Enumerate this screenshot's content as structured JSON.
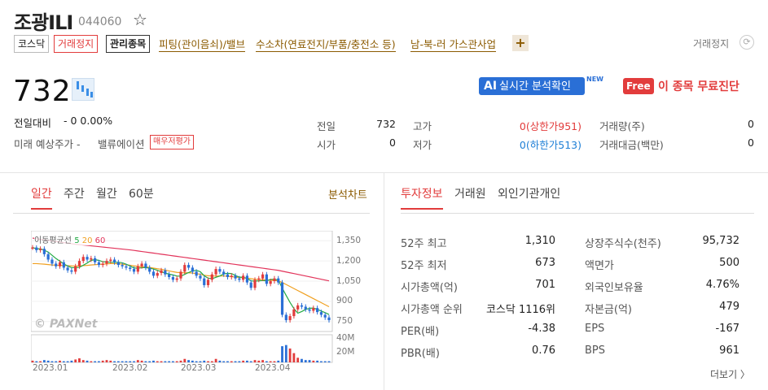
{
  "stock": {
    "name": "조광ILI",
    "code": "044060",
    "tags": [
      "코스닥",
      "거래정지",
      "관리종목"
    ],
    "themes": [
      "피팅(관이음쇠)/밸브",
      "수소차(연료전지/부품/충전소 등)",
      "남-북-러 가스관사업"
    ],
    "trade_status": "거래정지",
    "price": "732",
    "change_label": "전일대비",
    "change_value": "- 0 0.00%",
    "forecast_label": "미래 예상주가 -",
    "valuation_label": "밸류에이션",
    "valuation_badge": "매우저평가"
  },
  "promo": {
    "ai_prefix": "AI",
    "ai_text": "실시간 분석확인",
    "ai_new": "NEW",
    "free_badge": "Free",
    "free_text": "이 종목 무료진단"
  },
  "quote": {
    "prev_label": "전일",
    "prev_value": "732",
    "open_label": "시가",
    "open_value": "0",
    "high_label": "고가",
    "high_value": "0(상한가951)",
    "low_label": "저가",
    "low_value": "0(하한가513)",
    "vol_label": "거래량(주)",
    "vol_value": "0",
    "amt_label": "거래대금(백만)",
    "amt_value": "0"
  },
  "chart_tabs": [
    "일간",
    "주간",
    "월간",
    "60분"
  ],
  "chart_link": "분석차트",
  "info_tabs": [
    "투자정보",
    "거래원",
    "외인기관개인"
  ],
  "chart_data": {
    "type": "line",
    "legend_prefix": "이동평균선",
    "legend_items": [
      {
        "label": "5",
        "color": "#22aa44"
      },
      {
        "label": "20",
        "color": "#f0a020"
      },
      {
        "label": "60",
        "color": "#e2335a"
      }
    ],
    "watermark": "© PAXNet",
    "y_ticks": [
      "1,350",
      "1,200",
      "1,050",
      "900",
      "750"
    ],
    "vol_ticks": [
      "40M",
      "20M"
    ],
    "x_ticks": [
      "2023.01",
      "2023.02",
      "2023.03",
      "2023.04"
    ],
    "ylim": [
      700,
      1400
    ],
    "price": [
      1300,
      1280,
      1290,
      1250,
      1210,
      1180,
      1160,
      1190,
      1150,
      1130,
      1120,
      1160,
      1200,
      1230,
      1210,
      1220,
      1190,
      1170,
      1180,
      1200,
      1210,
      1190,
      1170,
      1160,
      1150,
      1140,
      1120,
      1160,
      1180,
      1150,
      1120,
      1090,
      1110,
      1130,
      1100,
      1080,
      1060,
      1070,
      1120,
      1170,
      1150,
      1120,
      1090,
      1070,
      1020,
      1060,
      1100,
      1140,
      1120,
      1100,
      1080,
      1090,
      1070,
      1060,
      1090,
      1040,
      1000,
      1060,
      1070,
      1100,
      1030,
      1050,
      1070,
      1040,
      800,
      760,
      790,
      840,
      870,
      860,
      840,
      830,
      850,
      820,
      800,
      780,
      760
    ],
    "ma20": [
      1180,
      1180,
      1178,
      1176,
      1173,
      1170,
      1168,
      1167,
      1166,
      1165,
      1163,
      1162,
      1163,
      1165,
      1167,
      1170,
      1172,
      1174,
      1176,
      1178,
      1180,
      1180,
      1179,
      1176,
      1172,
      1168,
      1163,
      1160,
      1158,
      1156,
      1152,
      1147,
      1142,
      1138,
      1132,
      1126,
      1120,
      1115,
      1113,
      1112,
      1112,
      1110,
      1106,
      1100,
      1094,
      1090,
      1088,
      1088,
      1088,
      1088,
      1086,
      1083,
      1080,
      1077,
      1076,
      1073,
      1068,
      1064,
      1062,
      1062,
      1058,
      1056,
      1055,
      1052,
      1040,
      1025,
      1010,
      995,
      980,
      965,
      950,
      935,
      920,
      905,
      890,
      875,
      860
    ],
    "ma60": [
      1370,
      1365,
      1360,
      1356,
      1352,
      1348,
      1344,
      1340,
      1336,
      1332,
      1328,
      1324,
      1321,
      1318,
      1315,
      1312,
      1309,
      1306,
      1303,
      1300,
      1297,
      1294,
      1291,
      1288,
      1285,
      1282,
      1278,
      1274,
      1270,
      1266,
      1262,
      1258,
      1254,
      1250,
      1246,
      1242,
      1238,
      1234,
      1230,
      1226,
      1222,
      1218,
      1214,
      1210,
      1206,
      1202,
      1198,
      1194,
      1190,
      1186,
      1182,
      1178,
      1174,
      1170,
      1166,
      1162,
      1158,
      1154,
      1150,
      1146,
      1142,
      1138,
      1134,
      1130,
      1124,
      1118,
      1112,
      1106,
      1100,
      1094,
      1088,
      1082,
      1076,
      1070,
      1064,
      1058,
      1052
    ],
    "volume": [
      3,
      2,
      2,
      4,
      3,
      2,
      2,
      3,
      2,
      2,
      3,
      5,
      7,
      4,
      3,
      2,
      2,
      2,
      3,
      4,
      3,
      2,
      2,
      2,
      2,
      2,
      2,
      4,
      3,
      2,
      2,
      3,
      2,
      2,
      2,
      2,
      2,
      2,
      3,
      6,
      4,
      3,
      2,
      2,
      3,
      2,
      2,
      6,
      3,
      2,
      2,
      2,
      2,
      2,
      3,
      3,
      2,
      4,
      3,
      4,
      2,
      2,
      2,
      3,
      28,
      30,
      24,
      16,
      8,
      6,
      4,
      4,
      3,
      3,
      2,
      2,
      2
    ],
    "vol_max": 45
  },
  "invest": {
    "rows_left": [
      {
        "label": "52주 최고",
        "value": "1,310"
      },
      {
        "label": "52주 최저",
        "value": "673"
      },
      {
        "label": "시가총액(억)",
        "value": "701"
      },
      {
        "label": "시가총액 순위",
        "value": "코스닥 1116위"
      },
      {
        "label": "PER(배)",
        "value": "-4.38"
      },
      {
        "label": "PBR(배)",
        "value": "0.76"
      }
    ],
    "rows_right": [
      {
        "label": "상장주식수(천주)",
        "value": "95,732"
      },
      {
        "label": "액면가",
        "value": "500"
      },
      {
        "label": "외국인보유율",
        "value": "4.76%"
      },
      {
        "label": "자본금(억)",
        "value": "479"
      },
      {
        "label": "EPS",
        "value": "-167"
      },
      {
        "label": "BPS",
        "value": "961"
      }
    ],
    "more": "더보기 〉"
  }
}
